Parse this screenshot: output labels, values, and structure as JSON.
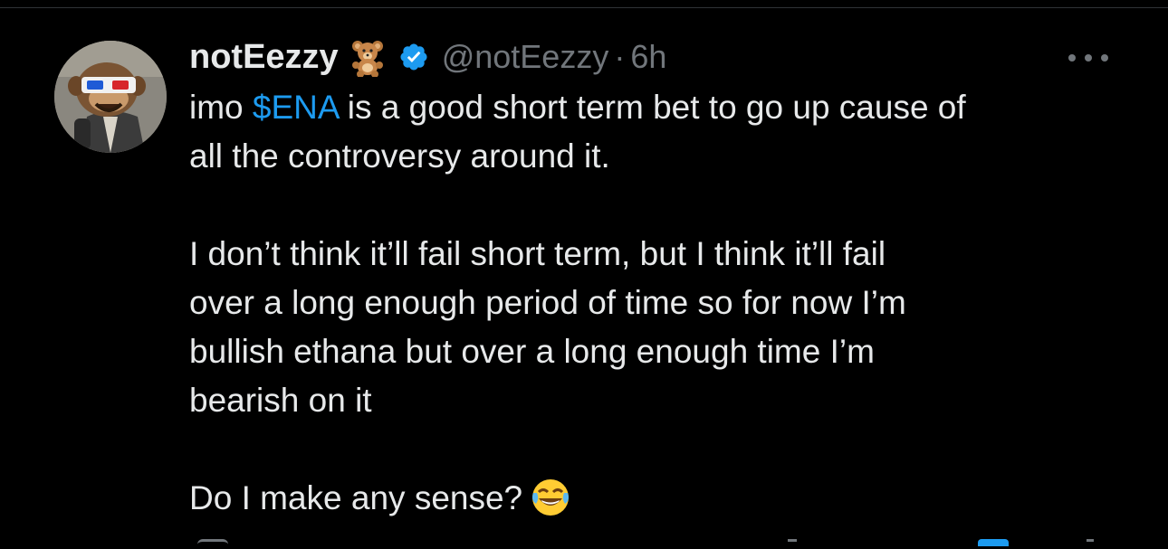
{
  "tweet": {
    "display_name": "notEezzy",
    "name_emoji": "teddy-bear-icon",
    "handle": "@notEezzy",
    "separator": "·",
    "time": "6h",
    "body": {
      "line1_prefix": "imo ",
      "cashtag": "$ENA",
      "line1_suffix": " is a good short term bet to go up cause of",
      "line2": "all the controversy around it.",
      "para2": [
        "I don’t think it’ll fail short term, but I think it’ll fail",
        "over a long enough period of time so for now I’m",
        "bullish ethana but over a long enough time I’m",
        "bearish on it"
      ],
      "para3": "Do I make any sense?",
      "para3_emoji": "face-with-tears-of-joy-icon"
    }
  },
  "colors": {
    "background": "#000000",
    "text": "#e7e9ea",
    "muted": "#71767b",
    "link": "#1d9bf0",
    "divider": "#2f3336"
  }
}
